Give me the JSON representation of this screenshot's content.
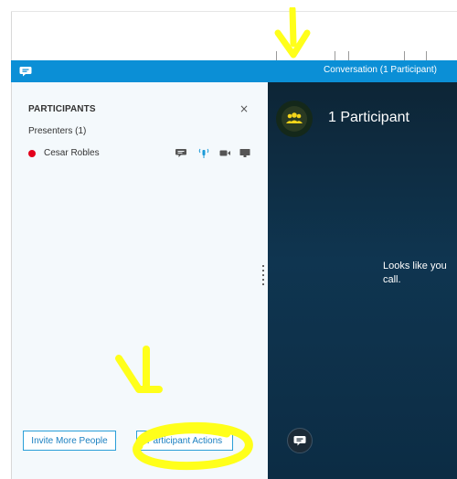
{
  "window": {
    "title": "Conversation (1 Participant)"
  },
  "participants_pane": {
    "header": "PARTICIPANTS",
    "close_glyph": "×",
    "group_label": "Presenters (1)",
    "participants": [
      {
        "name": "Cesar Robles",
        "status_color": "#e3001b",
        "modalities": [
          "chat-icon",
          "audio-icon",
          "video-icon",
          "screen-share-icon"
        ]
      }
    ],
    "invite_button": "Invite More People",
    "actions_button": "Participant Actions"
  },
  "stage": {
    "participant_count": "1 Participant",
    "message": "Looks like you call."
  },
  "colors": {
    "titlebar": "#0b8fd6",
    "accent": "#1a7fc0",
    "stage_bg": "#0f3550",
    "annotation": "#ffff1a"
  }
}
